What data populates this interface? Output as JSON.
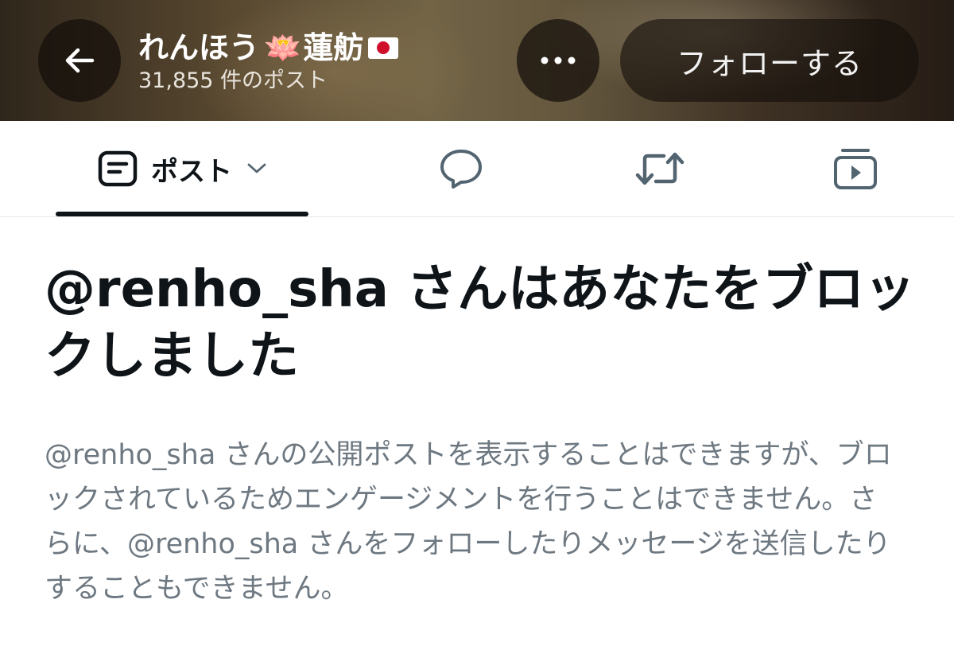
{
  "header": {
    "display_name": "れんほう",
    "lotus_emoji": "🪷",
    "display_name_suffix": "蓮舫",
    "flag": "🇯🇵",
    "post_count": "31,855 件のポスト",
    "follow_label": "フォローする",
    "back_icon": "arrow-left-icon",
    "more_icon": "more-horizontal-icon",
    "bg_color": "#5b4a35"
  },
  "tabs": {
    "posts_label": "ポスト",
    "active_underline_color": "#0f1419",
    "icons": [
      "posts-icon",
      "chevron-down-icon",
      "reply-icon",
      "repost-icon",
      "media-icon"
    ]
  },
  "blocked": {
    "title": "@renho_sha さんはあなたをブロックしました",
    "description": "@renho_sha さんの公開ポストを表示することはできますが、ブロックされているためエンゲージメントを行うことはできません。さらに、@renho_sha さんをフォローしたりメッセージを送信したりすることもできません。"
  },
  "colors": {
    "text_primary": "#0f1419",
    "text_secondary": "#6e7881",
    "icon_gray": "#536471"
  }
}
